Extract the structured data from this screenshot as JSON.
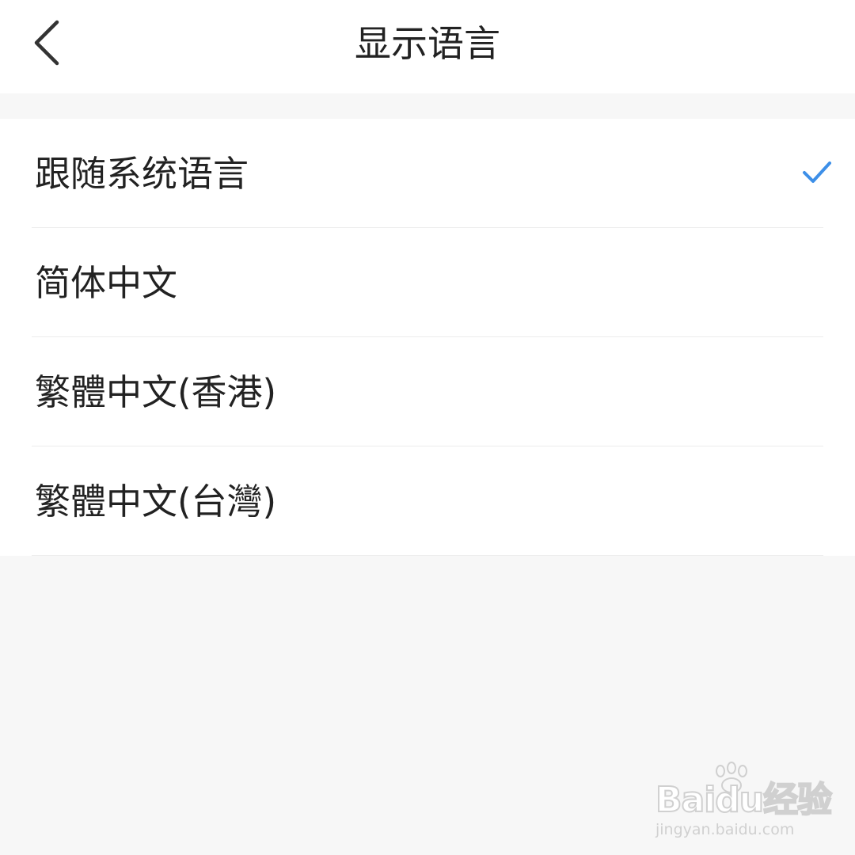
{
  "header": {
    "title": "显示语言",
    "back_icon": "chevron-left-icon"
  },
  "languages": [
    {
      "label": "跟随系统语言",
      "selected": true
    },
    {
      "label": "简体中文",
      "selected": false
    },
    {
      "label": "繁體中文(香港)",
      "selected": false
    },
    {
      "label": "繁體中文(台灣)",
      "selected": false
    }
  ],
  "check_icon": "checkmark-icon",
  "colors": {
    "accent": "#3d8fe8",
    "background": "#f7f7f7",
    "surface": "#ffffff",
    "text": "#222222",
    "divider": "#ececec"
  },
  "watermark": {
    "brand": "Baidu经验",
    "url": "jingyan.baidu.com"
  }
}
